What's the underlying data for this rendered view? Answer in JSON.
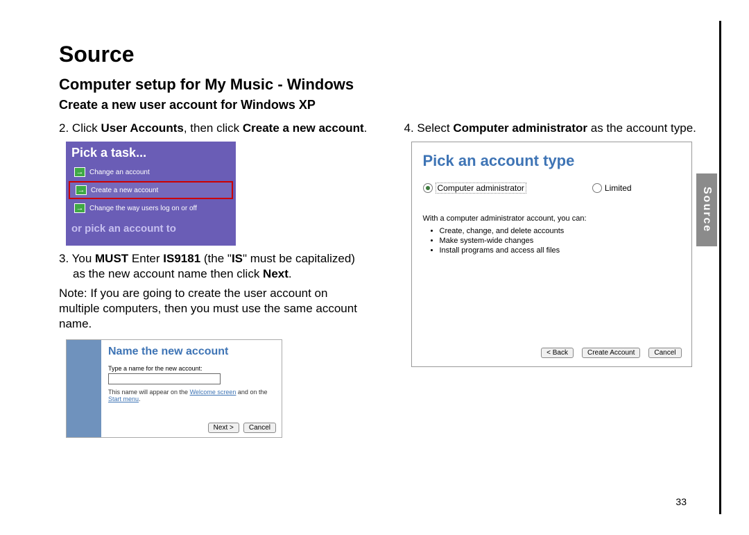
{
  "page_number": "33",
  "side_tab_label": "Source",
  "title": "Source",
  "subtitle": "Computer setup for My Music - Windows",
  "section_heading": "Create a new user account for Windows XP",
  "step2": {
    "num": "2.",
    "pre": " Click ",
    "b1": "User Accounts",
    "mid": ", then click ",
    "b2": "Create a new account",
    "post": "."
  },
  "step3": {
    "num": "3.",
    "pre": " You ",
    "b1": "MUST",
    "mid1": " Enter ",
    "b2": "IS9181",
    "mid2": " (the \"",
    "b3": "IS",
    "mid3": "\" must be capitalized) as the new account name then click ",
    "b4": "Next",
    "post": "."
  },
  "note": "Note: If you are going to create the user account on multiple computers, then you must use the same account name.",
  "step4": {
    "num": "4.",
    "pre": " Select ",
    "b1": "Computer administrator",
    "post": " as the account type."
  },
  "shot1": {
    "header": "Pick a task...",
    "task1": "Change an account",
    "task2": "Create a new account",
    "task3": "Change the way users log on or off",
    "footer": "or pick an account to"
  },
  "shot2": {
    "heading": "Name the new account",
    "label": "Type a name for the new account:",
    "hint_pre": "This name will appear on the ",
    "hint_link1": "Welcome screen",
    "hint_mid": " and on the ",
    "hint_link2": "Start menu",
    "hint_post": ".",
    "btn_next": "Next >",
    "btn_cancel": "Cancel"
  },
  "shot3": {
    "heading": "Pick an account type",
    "opt1": "Computer administrator",
    "opt2": "Limited",
    "desc": "With a computer administrator account, you can:",
    "bullets": [
      "Create, change, and delete accounts",
      "Make system-wide changes",
      "Install programs and access all files"
    ],
    "btn_back": "< Back",
    "btn_create": "Create Account",
    "btn_cancel": "Cancel"
  }
}
